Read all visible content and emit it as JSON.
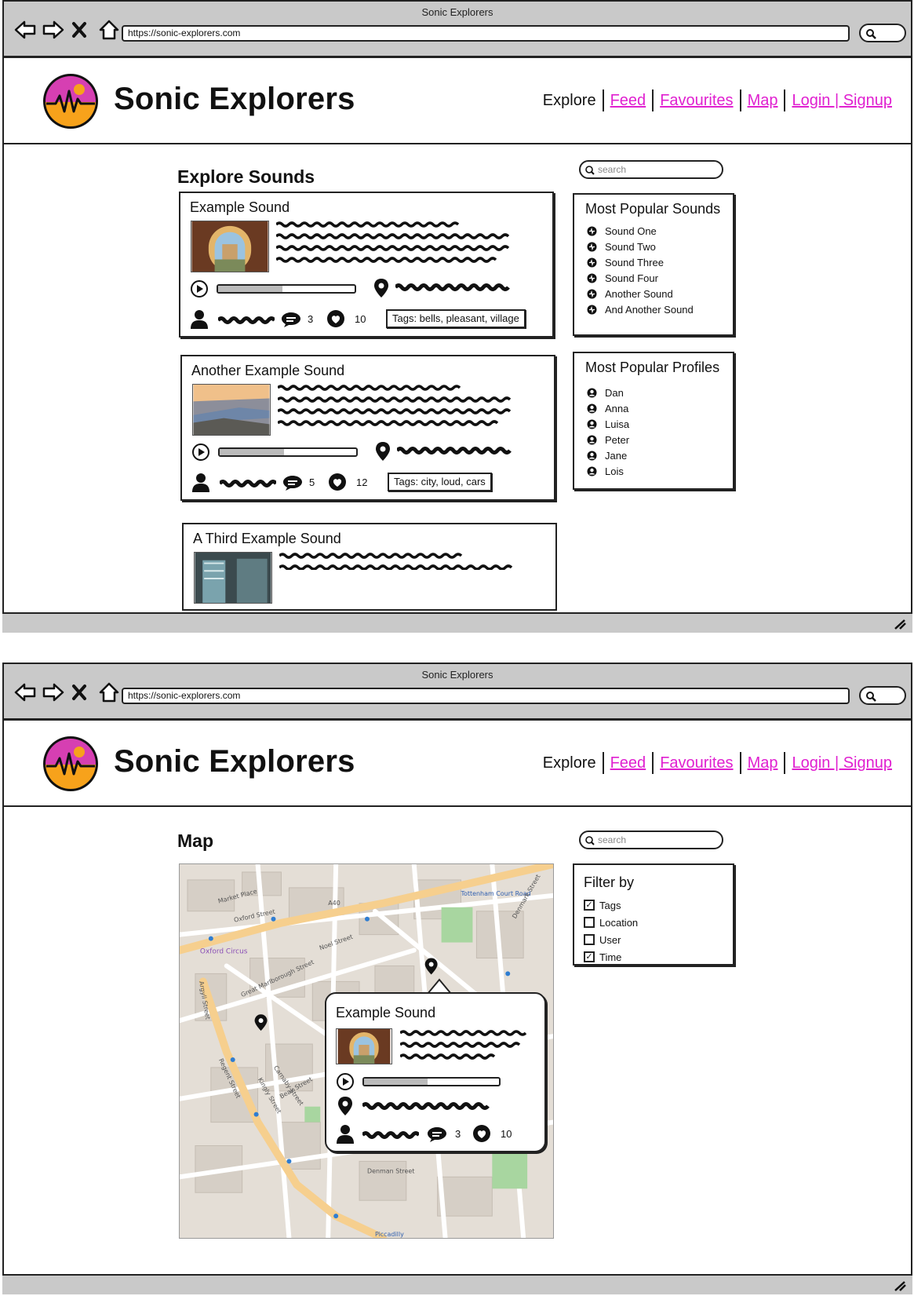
{
  "window": {
    "title": "Sonic Explorers",
    "url": "https://sonic-explorers.com"
  },
  "header": {
    "brand": "Sonic Explorers",
    "nav": [
      "Explore",
      "Feed",
      "Favourites",
      "Map",
      "Login | Signup"
    ],
    "active": "Explore",
    "link_color": "#e020d0"
  },
  "explore": {
    "title": "Explore Sounds",
    "search_placeholder": "search",
    "sounds": [
      {
        "title": "Example Sound",
        "comments": "3",
        "likes": "10",
        "tags": "Tags: bells, pleasant, village",
        "progress": 0.47
      },
      {
        "title": "Another Example Sound",
        "comments": "5",
        "likes": "12",
        "tags": "Tags: city, loud, cars",
        "progress": 0.47
      },
      {
        "title": "A Third Example Sound"
      }
    ],
    "popular_sounds": {
      "title": "Most Popular Sounds",
      "items": [
        "Sound One",
        "Sound Two",
        "Sound Three",
        "Sound Four",
        "Another Sound",
        "And Another Sound"
      ]
    },
    "popular_profiles": {
      "title": "Most Popular Profiles",
      "items": [
        "Dan",
        "Anna",
        "Luisa",
        "Peter",
        "Jane",
        "Lois"
      ]
    }
  },
  "map_page": {
    "title": "Map",
    "search_placeholder": "search",
    "popup": {
      "title": "Example Sound",
      "comments": "3",
      "likes": "10",
      "progress": 0.47
    },
    "filter": {
      "title": "Filter by",
      "options": [
        {
          "label": "Tags",
          "checked": true
        },
        {
          "label": "Location",
          "checked": false
        },
        {
          "label": "User",
          "checked": false
        },
        {
          "label": "Time",
          "checked": true
        }
      ]
    },
    "map_labels": [
      "Oxford Street",
      "Oxford Circus",
      "Regent Street",
      "Tottenham Court Road",
      "Denman Street",
      "Piccadilly",
      "Carnaby Street",
      "Kingly Street",
      "Great Marlborough Street",
      "Noel Street",
      "Market Place",
      "A40",
      "Denmark Street",
      "Beak Street",
      "Argyll Street"
    ]
  },
  "colors": {
    "logo_magenta": "#d63fb2",
    "logo_orange": "#f7a21b",
    "chrome_gray": "#c9c9c9"
  }
}
